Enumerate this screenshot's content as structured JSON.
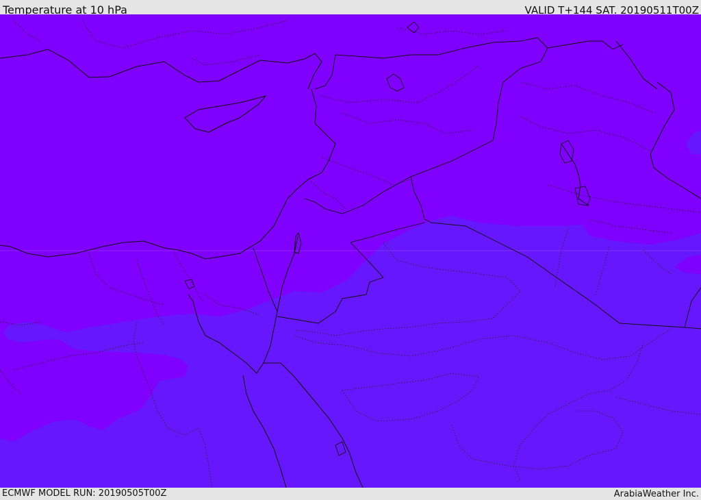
{
  "header": {
    "title": "Temperature at 10 hPa",
    "valid_time": "VALID T+144 SAT. 20190511T00Z"
  },
  "footer": {
    "model_run": "ECMWF MODEL RUN: 20190505T00Z",
    "credit": "ArabiaWeather Inc."
  },
  "map": {
    "field_colors": {
      "warmer_zone": "#7f00fe",
      "cooler_zone": "#6617fe"
    },
    "boundary_color": "#000000"
  }
}
